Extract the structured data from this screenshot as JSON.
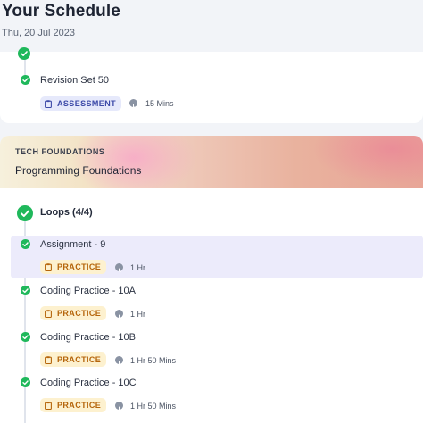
{
  "header": {
    "title": "Your Schedule",
    "date": "Thu, 20 Jul 2023"
  },
  "colors": {
    "completed": "#1fb85b",
    "assessment_badge": "#3d4aa8",
    "practice_badge": "#b5650b",
    "highlight_row": "#ecebfb"
  },
  "section1": {
    "items": [
      {
        "title": "Revision Set 50",
        "status": "completed",
        "tag": "ASSESSMENT",
        "tag_icon": "clipboard-icon",
        "duration": "15 Mins"
      }
    ]
  },
  "section2": {
    "category": "TECH FOUNDATIONS",
    "course": "Programming Foundations",
    "module": {
      "title": "Loops (4/4)",
      "status": "completed",
      "items": [
        {
          "title": "Assignment - 9",
          "status": "completed",
          "tag": "PRACTICE",
          "tag_icon": "clipboard-icon",
          "duration": "1 Hr",
          "highlighted": true
        },
        {
          "title": "Coding Practice - 10A",
          "status": "completed",
          "tag": "PRACTICE",
          "tag_icon": "clipboard-icon",
          "duration": "1 Hr"
        },
        {
          "title": "Coding Practice - 10B",
          "status": "completed",
          "tag": "PRACTICE",
          "tag_icon": "clipboard-icon",
          "duration": "1 Hr 50 Mins"
        },
        {
          "title": "Coding Practice - 10C",
          "status": "completed",
          "tag": "PRACTICE",
          "tag_icon": "clipboard-icon",
          "duration": "1 Hr 50 Mins"
        }
      ]
    }
  }
}
